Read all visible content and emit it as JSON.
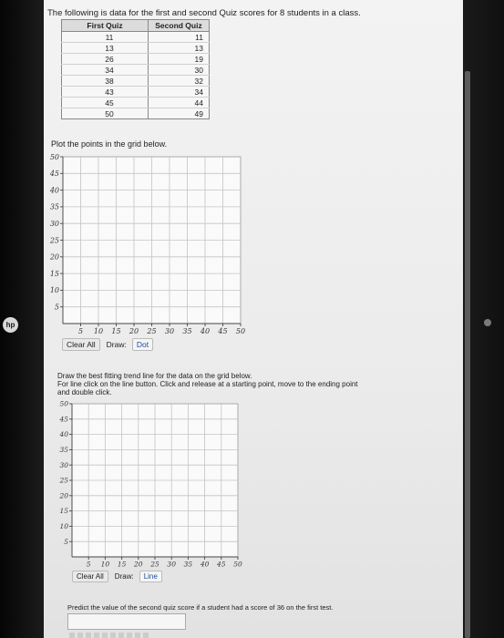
{
  "device": {
    "logo_text": "hp"
  },
  "intro_text": "The following is data for the first and second Quiz scores for 8 students in a class.",
  "table": {
    "headers": [
      "First Quiz",
      "Second Quiz"
    ],
    "rows": [
      [
        "11",
        "11"
      ],
      [
        "13",
        "13"
      ],
      [
        "26",
        "19"
      ],
      [
        "34",
        "30"
      ],
      [
        "38",
        "32"
      ],
      [
        "43",
        "34"
      ],
      [
        "45",
        "44"
      ],
      [
        "50",
        "49"
      ]
    ]
  },
  "plot1": {
    "label": "Plot the points in the grid below.",
    "y_ticks": [
      "50",
      "45",
      "40",
      "35",
      "30",
      "25",
      "20",
      "15",
      "10",
      "5"
    ],
    "x_ticks": [
      "5",
      "10",
      "15",
      "20",
      "25",
      "30",
      "35",
      "40",
      "45",
      "50"
    ],
    "clear_label": "Clear All",
    "draw_label": "Draw:",
    "mode_label": "Dot"
  },
  "plot2": {
    "instruction_lines": [
      "Draw the best fitting trend line for the data on the grid below.",
      "For line click on the line button. Click and release at a starting point, move to the ending point",
      "and double click."
    ],
    "y_ticks": [
      "50",
      "45",
      "40",
      "35",
      "30",
      "25",
      "20",
      "15",
      "10",
      "5"
    ],
    "x_ticks": [
      "5",
      "10",
      "15",
      "20",
      "25",
      "30",
      "35",
      "40",
      "45",
      "50"
    ],
    "clear_label": "Clear All",
    "draw_label": "Draw:",
    "mode_label": "Line"
  },
  "predict_text": "Predict the value of the second quiz score if a student had a score of 36 on the first test.",
  "answer_value": ""
}
